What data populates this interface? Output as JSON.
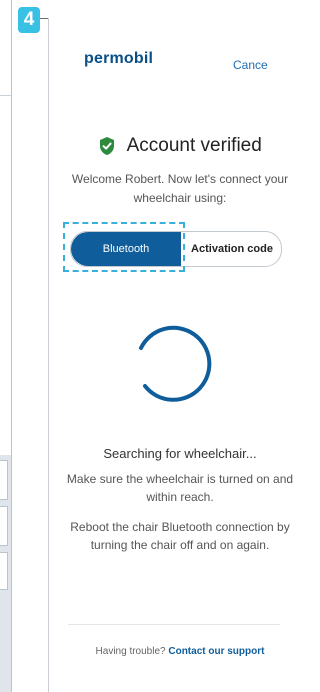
{
  "step": {
    "number": "4"
  },
  "header": {
    "brand": "permobil",
    "cancel_label": "Cance"
  },
  "verification": {
    "title": "Account verified"
  },
  "welcome": {
    "text": "Welcome Robert. Now let's connect your wheelchair using:"
  },
  "connect_options": {
    "selected": "Bluetooth",
    "bluetooth_label": "Bluetooth",
    "activation_label": "Activation code"
  },
  "status": {
    "searching": "Searching for wheelchair...",
    "hint_1": "Make sure the wheelchair is turned on and within reach.",
    "hint_2": "Reboot the chair Bluetooth connection by turning the chair off and on again."
  },
  "footer": {
    "prompt": "Having trouble?",
    "link": "Contact our support"
  },
  "colors": {
    "accent": "#0f5d9a",
    "badge": "#39c0e5",
    "verified_green": "#2e8b3e",
    "spinner": "#0f5d9a"
  },
  "icons": {
    "verified": "shield-check-icon",
    "loading": "spinner-icon"
  }
}
